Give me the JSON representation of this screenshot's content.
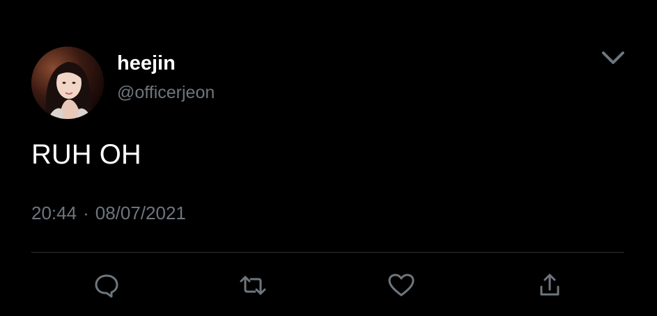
{
  "tweet": {
    "author": {
      "display_name": "heejin",
      "handle": "@officerjeon",
      "avatar_icon": "profile-photo"
    },
    "menu_icon": "chevron-down-icon",
    "text": "RUH OH",
    "time": "20:44",
    "separator": "·",
    "date": "08/07/2021"
  },
  "actions": [
    {
      "name": "reply",
      "icon": "reply-icon"
    },
    {
      "name": "retweet",
      "icon": "retweet-icon"
    },
    {
      "name": "like",
      "icon": "heart-icon"
    },
    {
      "name": "share",
      "icon": "share-icon"
    }
  ],
  "colors": {
    "background": "#000000",
    "primary_text": "#ffffff",
    "secondary_text": "#6e767d",
    "divider": "#2f3336",
    "icon": "#6e767d"
  }
}
